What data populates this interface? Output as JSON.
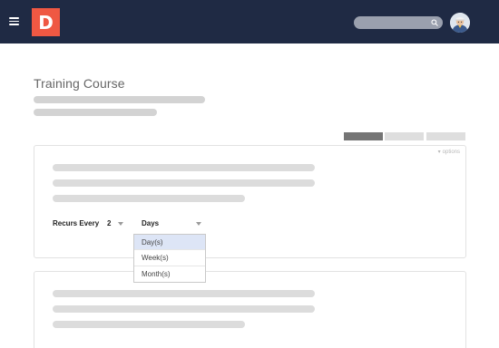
{
  "header": {
    "logo_letter": "D",
    "search": {
      "placeholder": ""
    }
  },
  "page": {
    "title": "Training Course",
    "tabs": [
      {
        "state": "active"
      },
      {
        "state": "inactive"
      },
      {
        "state": "inactive"
      }
    ]
  },
  "card1": {
    "options_label": "options",
    "recurs_label": "Recurs Every",
    "interval_value": "2",
    "unit_value": "Days"
  },
  "dropdown": {
    "options": [
      "Day(s)",
      "Week(s)",
      "Month(s)"
    ],
    "selected_index": 0
  },
  "colors": {
    "header_bg": "#1f2a44",
    "brand": "#ef5843",
    "skeleton": "#d3d3d3",
    "active_tab": "#757575",
    "selected_option_bg": "#dde5f6"
  },
  "icons": [
    "hamburger-icon",
    "search-icon",
    "avatar",
    "chevron-down-icon"
  ]
}
